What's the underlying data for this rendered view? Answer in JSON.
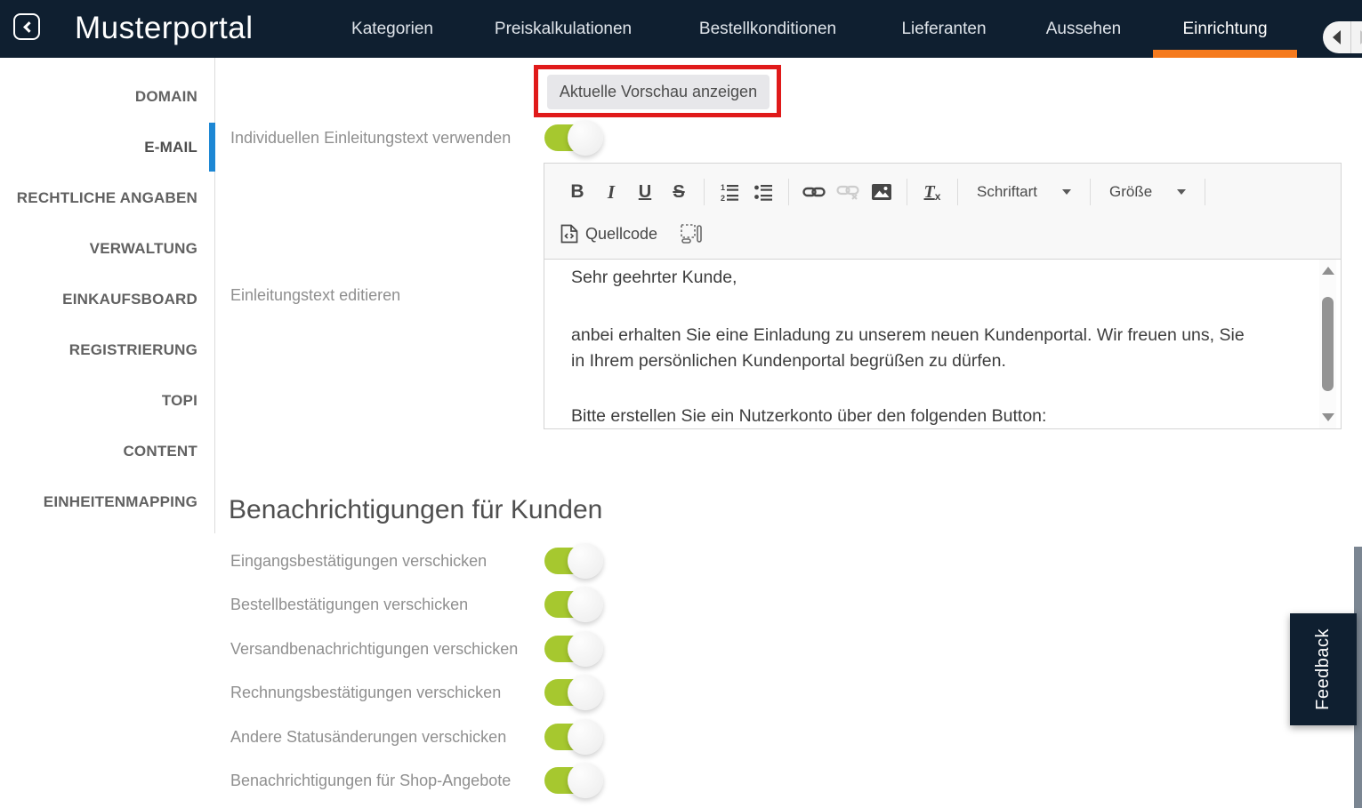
{
  "topbar": {
    "brand": "Musterportal",
    "nav_items": [
      {
        "label": "Kategorien",
        "active": false
      },
      {
        "label": "Preiskalkulationen",
        "active": false
      },
      {
        "label": "Bestellkonditionen",
        "active": false
      },
      {
        "label": "Lieferanten",
        "active": false
      },
      {
        "label": "Aussehen",
        "active": false
      },
      {
        "label": "Einrichtung",
        "active": true
      }
    ],
    "scroller": {
      "left_enabled": true,
      "right_enabled": false
    }
  },
  "sidebar": {
    "items": [
      {
        "label": "DOMAIN",
        "active": false
      },
      {
        "label": "E-MAIL",
        "active": true
      },
      {
        "label": "RECHTLICHE ANGABEN",
        "active": false
      },
      {
        "label": "VERWALTUNG",
        "active": false
      },
      {
        "label": "EINKAUFSBOARD",
        "active": false
      },
      {
        "label": "REGISTRIERUNG",
        "active": false
      },
      {
        "label": "TOPI",
        "active": false
      },
      {
        "label": "CONTENT",
        "active": false
      },
      {
        "label": "EINHEITENMAPPING",
        "active": false
      }
    ]
  },
  "main": {
    "preview_button_label": "Aktuelle Vorschau anzeigen",
    "intro_toggle": {
      "label": "Individuellen Einleitungstext verwenden",
      "on": true
    },
    "editor_field_label": "Einleitungstext editieren",
    "editor": {
      "toolbar": {
        "bold": "B",
        "italic": "I",
        "underline": "U",
        "strike": "S",
        "remove_format_t": "T",
        "remove_format_x": "x",
        "font_dropdown": "Schriftart",
        "size_dropdown": "Größe",
        "source_label": "Quellcode",
        "icons": [
          "bold-icon",
          "italic-icon",
          "underline-icon",
          "strikethrough-icon",
          "ordered-list-icon",
          "bulleted-list-icon",
          "link-icon",
          "unlink-icon",
          "image-icon",
          "remove-format-icon",
          "source-icon",
          "show-blocks-icon"
        ]
      },
      "content": {
        "p1": "Sehr geehrter Kunde,",
        "p2": "anbei erhalten Sie eine Einladung zu unserem neuen Kundenportal. Wir freuen uns, Sie in Ihrem persönlichen Kundenportal begrüßen zu dürfen.",
        "p3": "Bitte erstellen Sie ein Nutzerkonto über den folgenden Button:"
      }
    },
    "notifications": {
      "heading": "Benachrichtigungen für Kunden",
      "toggles": [
        {
          "label": "Eingangsbestätigungen verschicken",
          "on": true
        },
        {
          "label": "Bestellbestätigungen verschicken",
          "on": true
        },
        {
          "label": "Versandbenachrichtigungen verschicken",
          "on": true
        },
        {
          "label": "Rechnungsbestätigungen verschicken",
          "on": true
        },
        {
          "label": "Andere Statusänderungen verschicken",
          "on": true
        },
        {
          "label": "Benachrichtigungen für Shop-Angebote",
          "on": true
        }
      ]
    }
  },
  "feedback_tab": {
    "label": "Feedback"
  },
  "colors": {
    "navbar_bg": "#0f1f30",
    "accent_orange": "#f57a1d",
    "active_blue": "#1d87d4",
    "toggle_green": "#a6c82f",
    "annotation_red": "#e01a1a"
  }
}
